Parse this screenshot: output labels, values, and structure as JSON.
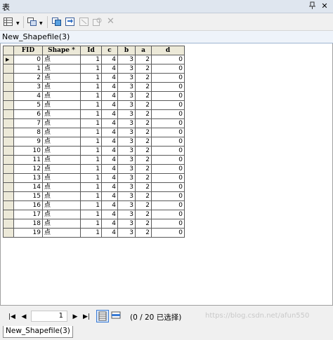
{
  "window": {
    "title": "表"
  },
  "tab": {
    "name": "New_Shapefile(3)"
  },
  "table": {
    "headers": [
      "FID",
      "Shape *",
      "Id",
      "c",
      "b",
      "a",
      "d"
    ],
    "rows": [
      [
        "0",
        "点",
        "1",
        "4",
        "3",
        "2",
        "0"
      ],
      [
        "1",
        "点",
        "1",
        "4",
        "3",
        "2",
        "0"
      ],
      [
        "2",
        "点",
        "1",
        "4",
        "3",
        "2",
        "0"
      ],
      [
        "3",
        "点",
        "1",
        "4",
        "3",
        "2",
        "0"
      ],
      [
        "4",
        "点",
        "1",
        "4",
        "3",
        "2",
        "0"
      ],
      [
        "5",
        "点",
        "1",
        "4",
        "3",
        "2",
        "0"
      ],
      [
        "6",
        "点",
        "1",
        "4",
        "3",
        "2",
        "0"
      ],
      [
        "7",
        "点",
        "1",
        "4",
        "3",
        "2",
        "0"
      ],
      [
        "8",
        "点",
        "1",
        "4",
        "3",
        "2",
        "0"
      ],
      [
        "9",
        "点",
        "1",
        "4",
        "3",
        "2",
        "0"
      ],
      [
        "10",
        "点",
        "1",
        "4",
        "3",
        "2",
        "0"
      ],
      [
        "11",
        "点",
        "1",
        "4",
        "3",
        "2",
        "0"
      ],
      [
        "12",
        "点",
        "1",
        "4",
        "3",
        "2",
        "0"
      ],
      [
        "13",
        "点",
        "1",
        "4",
        "3",
        "2",
        "0"
      ],
      [
        "14",
        "点",
        "1",
        "4",
        "3",
        "2",
        "0"
      ],
      [
        "15",
        "点",
        "1",
        "4",
        "3",
        "2",
        "0"
      ],
      [
        "16",
        "点",
        "1",
        "4",
        "3",
        "2",
        "0"
      ],
      [
        "17",
        "点",
        "1",
        "4",
        "3",
        "2",
        "0"
      ],
      [
        "18",
        "点",
        "1",
        "4",
        "3",
        "2",
        "0"
      ],
      [
        "19",
        "点",
        "1",
        "4",
        "3",
        "2",
        "0"
      ]
    ]
  },
  "navigation": {
    "current_record": "1",
    "selection_info": "(0 / 20 已选择)"
  },
  "bottom_tab": {
    "name": "New_Shapefile(3)"
  },
  "watermark": "https://blog.csdn.net/afun550",
  "icons": {
    "pin": "pin-icon",
    "close": "close-icon",
    "table_options": "table-options-icon",
    "related_tables": "related-tables-icon",
    "select_by_attributes": "select-by-attributes-icon",
    "switch_selection": "switch-selection-icon",
    "clear_selection": "clear-selection-icon",
    "zoom_to_selected": "zoom-to-selected-icon",
    "delete_selected": "delete-selected-icon",
    "show_all_records": "show-all-records-icon",
    "show_selected_records": "show-selected-records-icon"
  },
  "colors": {
    "header_bg": "#ece9d8",
    "grid_border": "#5a5a5a",
    "title_bar": "#dfe6ef",
    "active_view": "#3a7bd5"
  }
}
